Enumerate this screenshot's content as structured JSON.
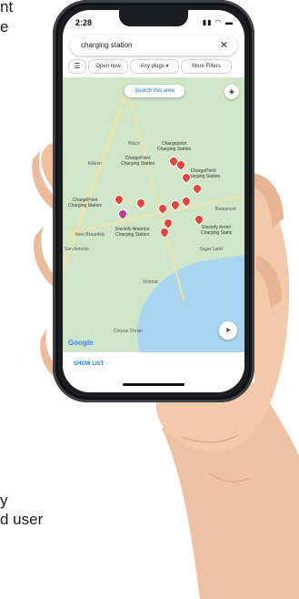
{
  "edge_text": [
    "nt",
    "e",
    "y",
    "d user"
  ],
  "phone": {
    "time": "2:28",
    "status_icons": "▮▮ ◠ ▬",
    "search_query": "charging station",
    "close_glyph": "✕",
    "chips": {
      "filter_icon": "☰",
      "open_now": "Open now",
      "any_plugs": "Any plugs ▾",
      "more_filters": "More Filters"
    },
    "map": {
      "search_area_button": "Search this area",
      "layers_glyph": "◈",
      "locate_glyph": "➤",
      "google_logo": "Google",
      "labels": [
        "Chargepoint\nCharging Station",
        "ChargePoint\nCharging Station",
        "ChargePoint\nCharging Station",
        "ChargePoint\nCharging Station",
        "Electrify America\nCharging Station",
        "Electrify Ameri\nCharging Statio"
      ],
      "cities": [
        "Waco",
        "Killeen",
        "New Braunfels",
        "San Antonio",
        "Victoria",
        "Corpus Christi",
        "Sugar Land",
        "Beaumont"
      ]
    },
    "show_list": "SHOW LIST"
  },
  "colors": {
    "map_land": "#cfe6c9",
    "map_water": "#a9d5ee",
    "pin": "#e2453c",
    "link_blue": "#1a73e8",
    "phone_frame": "#1b1d20",
    "skin": "#f0c3a4"
  }
}
